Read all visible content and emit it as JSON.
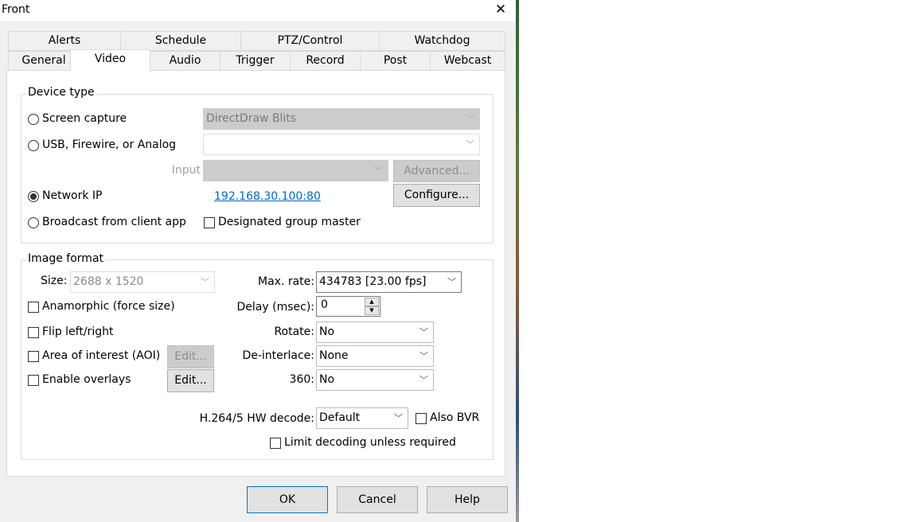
{
  "window": {
    "title": "Front",
    "close_glyph": "✕"
  },
  "tabs": {
    "row1": [
      "Alerts",
      "Schedule",
      "PTZ/Control",
      "Watchdog"
    ],
    "row2": [
      "General",
      "Video",
      "Audio",
      "Trigger",
      "Record",
      "Post",
      "Webcast"
    ],
    "active": "Video"
  },
  "device_type": {
    "legend": "Device type",
    "screen_capture": {
      "label": "Screen capture",
      "selected": false,
      "dropdown_value": "DirectDraw Blits"
    },
    "usb": {
      "label": "USB, Firewire, or Analog",
      "selected": false,
      "dropdown_value": ""
    },
    "input": {
      "label": "Input",
      "dropdown_value": "",
      "advanced_label": "Advanced..."
    },
    "network_ip": {
      "label": "Network IP",
      "selected": true,
      "address": "192.168.30.100:80",
      "configure_label": "Configure..."
    },
    "broadcast": {
      "label": "Broadcast from client app",
      "selected": false
    },
    "designated_master": {
      "label": "Designated group master",
      "checked": false
    }
  },
  "image_format": {
    "legend": "Image format",
    "size": {
      "label": "Size:",
      "value": "2688 x 1520"
    },
    "anamorphic": {
      "label": "Anamorphic (force size)",
      "checked": false
    },
    "flip": {
      "label": "Flip left/right",
      "checked": false
    },
    "aoi": {
      "label": "Area of interest (AOI)",
      "checked": false,
      "edit_label": "Edit..."
    },
    "overlays": {
      "label": "Enable overlays",
      "checked": false,
      "edit_label": "Edit..."
    },
    "max_rate": {
      "label": "Max. rate:",
      "value": "434783 [23.00 fps]"
    },
    "delay": {
      "label": "Delay (msec):",
      "value": "0"
    },
    "rotate": {
      "label": "Rotate:",
      "value": "No"
    },
    "deinterlace": {
      "label": "De-interlace:",
      "value": "None"
    },
    "three_sixty": {
      "label": "360:",
      "value": "No"
    },
    "hw_decode": {
      "label": "H.264/5 HW decode:",
      "value": "Default"
    },
    "also_bvr": {
      "label": "Also BVR",
      "checked": false
    },
    "limit_decoding": {
      "label": "Limit decoding unless required",
      "checked": false
    }
  },
  "buttons": {
    "ok": "OK",
    "cancel": "Cancel",
    "help": "Help"
  },
  "icons": {
    "dropdown": "chevron-down-icon",
    "spin_up": "▲",
    "spin_down": "▼",
    "chevron": "﹀"
  },
  "colors": {
    "link": "#0066cc",
    "dialog_bg": "#f0f0f0",
    "default_button_border": "#0078d7"
  }
}
